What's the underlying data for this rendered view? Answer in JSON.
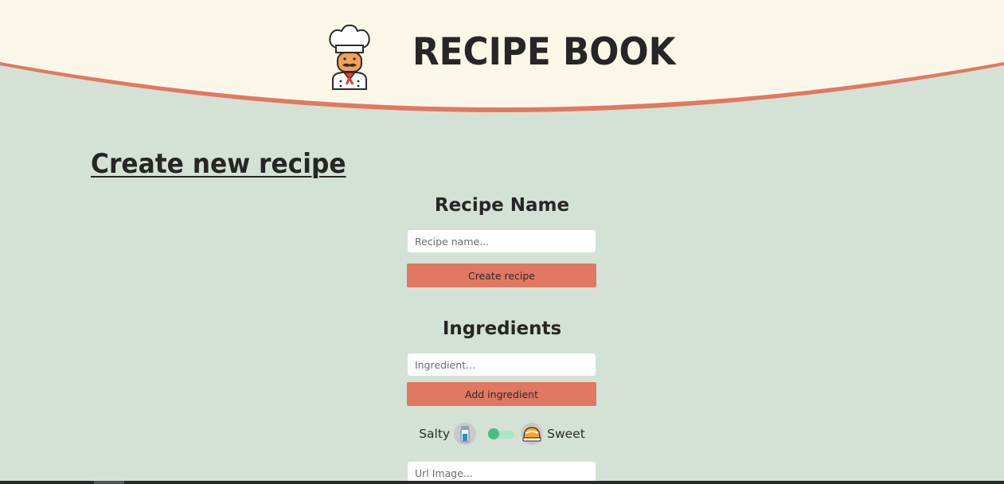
{
  "header": {
    "title": "RECIPE BOOK",
    "logo_icon": "chef-icon"
  },
  "page": {
    "title": "Create new recipe"
  },
  "recipe_name": {
    "heading": "Recipe Name",
    "placeholder": "Recipe name...",
    "button_label": "Create recipe"
  },
  "ingredients": {
    "heading": "Ingredients",
    "placeholder": "Ingredient...",
    "button_label": "Add ingredient"
  },
  "flavor": {
    "salty_label": "Salty",
    "sweet_label": "Sweet",
    "salty_icon": "salt-shaker-icon",
    "sweet_icon": "cake-icon",
    "toggle_state": "salty"
  },
  "image_url": {
    "placeholder": "Url Image..."
  },
  "colors": {
    "background": "#d3e2d4",
    "header": "#fbf7e8",
    "accent": "#e07862",
    "toggle": "#49bb84"
  }
}
